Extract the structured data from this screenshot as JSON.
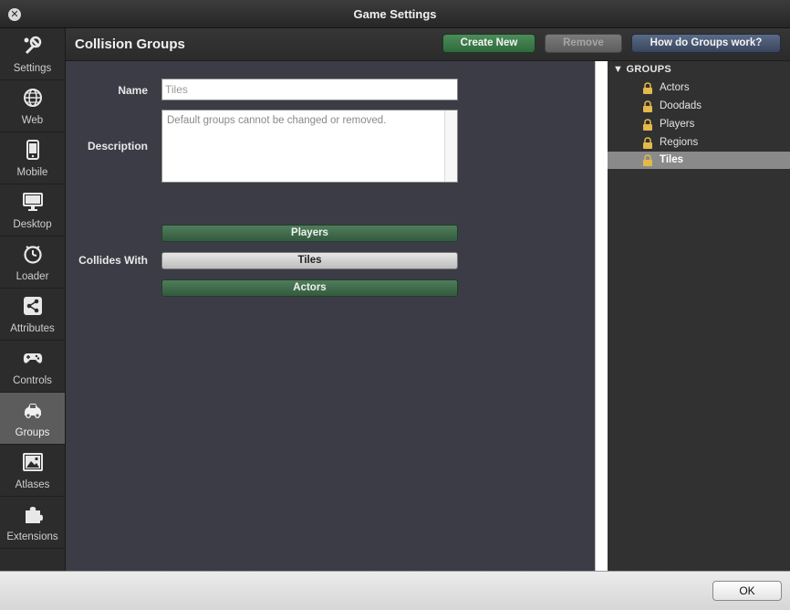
{
  "window": {
    "title": "Game Settings"
  },
  "sidebar": {
    "items": [
      {
        "label": "Settings",
        "icon": "wrench-icon"
      },
      {
        "label": "Web",
        "icon": "globe-icon"
      },
      {
        "label": "Mobile",
        "icon": "phone-icon"
      },
      {
        "label": "Desktop",
        "icon": "monitor-icon"
      },
      {
        "label": "Loader",
        "icon": "clock-icon"
      },
      {
        "label": "Attributes",
        "icon": "share-icon"
      },
      {
        "label": "Controls",
        "icon": "gamepad-icon"
      },
      {
        "label": "Groups",
        "icon": "car-icon",
        "active": true
      },
      {
        "label": "Atlases",
        "icon": "image-icon"
      },
      {
        "label": "Extensions",
        "icon": "puzzle-icon"
      }
    ]
  },
  "header": {
    "title": "Collision Groups",
    "create_label": "Create New",
    "remove_label": "Remove",
    "howto_label": "How do Groups work?"
  },
  "form": {
    "name_label": "Name",
    "name_value": "Tiles",
    "description_label": "Description",
    "description_value": "Default groups cannot be changed or removed.",
    "collides_label": "Collides With",
    "collides": [
      {
        "label": "Players",
        "state": "on"
      },
      {
        "label": "Tiles",
        "state": "off"
      },
      {
        "label": "Actors",
        "state": "on"
      }
    ]
  },
  "tree": {
    "root_label": "GROUPS",
    "items": [
      {
        "label": "Actors"
      },
      {
        "label": "Doodads"
      },
      {
        "label": "Players"
      },
      {
        "label": "Regions"
      },
      {
        "label": "Tiles",
        "selected": true
      }
    ]
  },
  "footer": {
    "ok_label": "OK"
  },
  "colors": {
    "accent_green": "#2f6a3c",
    "accent_blue": "#39455e",
    "content_bg": "#3c3c46",
    "selection": "#8a8a8a"
  }
}
